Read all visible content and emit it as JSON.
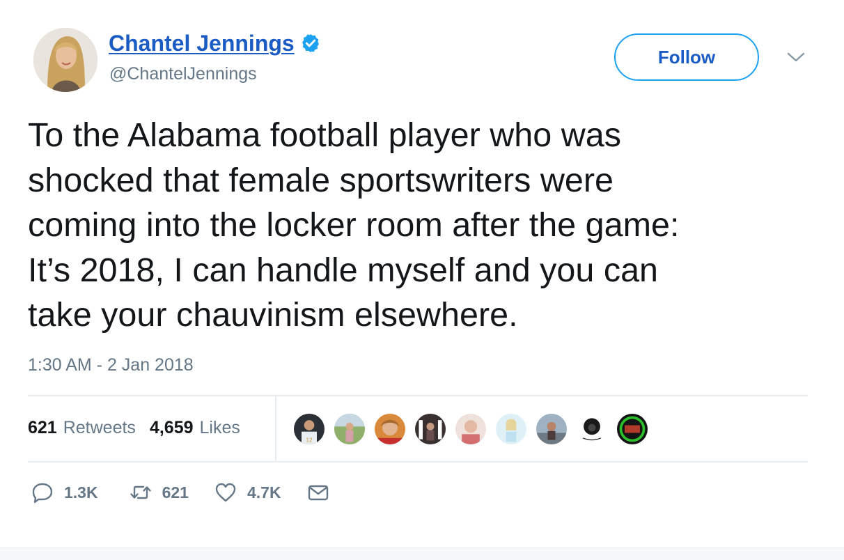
{
  "user": {
    "name": "Chantel Jennings",
    "handle": "@ChantelJennings",
    "verified": true
  },
  "header": {
    "follow_label": "Follow"
  },
  "tweet": {
    "lines": [
      "To the Alabama football player who was",
      "shocked that female sportswriters were",
      "coming into the locker room after the game:",
      "It’s 2018, I can handle myself and you can",
      "take your chauvinism elsewhere."
    ],
    "timestamp": "1:30 AM - 2 Jan 2018"
  },
  "stats": {
    "retweets_count": "621",
    "retweets_label": "Retweets",
    "likes_count": "4,659",
    "likes_label": "Likes"
  },
  "actions": {
    "reply_count": "1.3K",
    "retweet_count": "621",
    "like_count": "4.7K"
  },
  "colors": {
    "accent": "#1da1f2",
    "link": "#1b5cc4",
    "muted": "#657786",
    "divider": "#e6ecf0"
  },
  "icons": {
    "verified": "verified-badge-icon",
    "caret": "chevron-down-icon",
    "reply": "reply-icon",
    "retweet": "retweet-icon",
    "like": "heart-icon",
    "dm": "envelope-icon"
  }
}
